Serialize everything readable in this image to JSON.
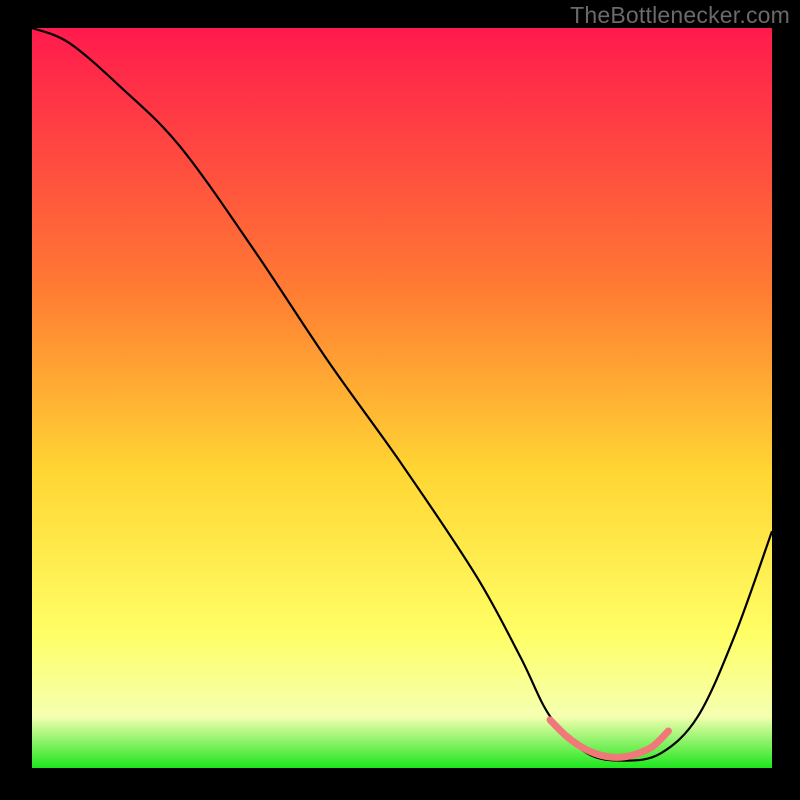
{
  "watermark": "TheBottlenecker.com",
  "chart_data": {
    "type": "line",
    "title": "",
    "xlabel": "",
    "ylabel": "",
    "xlim": [
      0,
      100
    ],
    "ylim": [
      0,
      100
    ],
    "series": [
      {
        "name": "curve",
        "x": [
          0,
          5,
          12,
          20,
          30,
          40,
          50,
          60,
          66,
          70,
          75,
          80,
          85,
          90,
          95,
          100
        ],
        "values": [
          100,
          98,
          92,
          84,
          70,
          55,
          41,
          26,
          15,
          7,
          2,
          1,
          2,
          7,
          18,
          32
        ]
      },
      {
        "name": "marker-band",
        "x": [
          70,
          72,
          74,
          76,
          78,
          80,
          82,
          84,
          86
        ],
        "values": [
          6.5,
          4.5,
          3.0,
          2.0,
          1.5,
          1.5,
          2.0,
          3.0,
          5.0
        ]
      }
    ],
    "colors": {
      "curve": "#000000",
      "marker": "#f07878",
      "gradient_top": "#ff1a4d",
      "gradient_mid1": "#ff7a33",
      "gradient_mid2": "#ffd633",
      "gradient_low": "#ffff66",
      "gradient_band": "#f5ffb0",
      "gradient_bottom": "#1ee61e"
    }
  }
}
